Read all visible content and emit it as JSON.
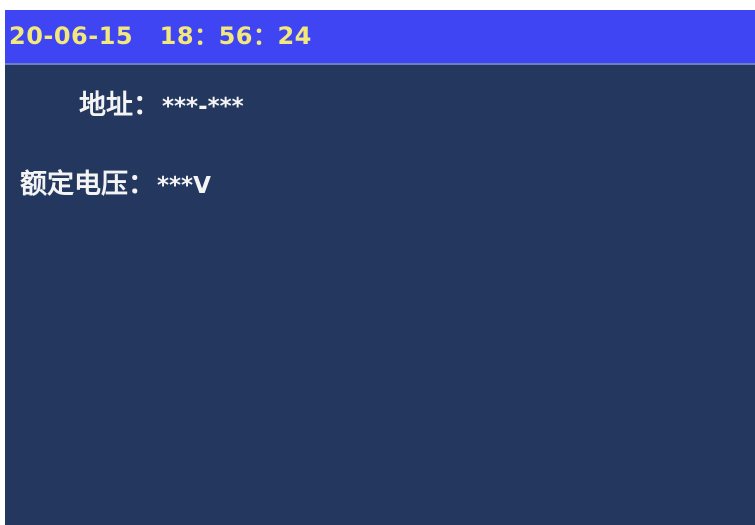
{
  "status_bar": {
    "datetime": "20-06-15   18：56：24"
  },
  "fields": {
    "address": {
      "label": "地址：",
      "value": "***-***"
    },
    "rated_voltage": {
      "label": "额定电压：",
      "value": "***V"
    }
  }
}
